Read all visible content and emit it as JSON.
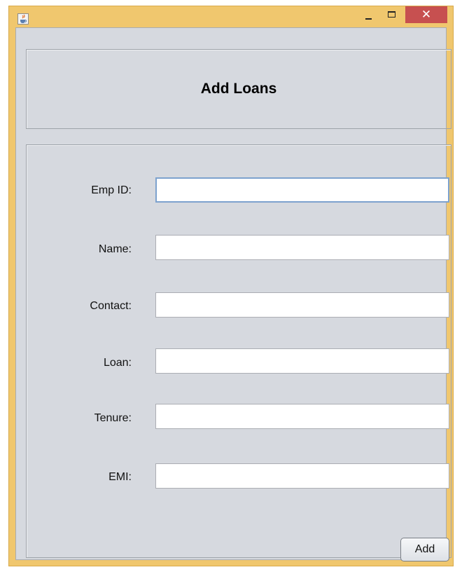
{
  "window": {
    "title": "",
    "controls": {
      "close_glyph": "✕"
    }
  },
  "header": {
    "title": "Add Loans"
  },
  "form": {
    "fields": [
      {
        "label": "Emp ID:",
        "value": "",
        "focused": true
      },
      {
        "label": "Name:",
        "value": "",
        "focused": false
      },
      {
        "label": "Contact:",
        "value": "",
        "focused": false
      },
      {
        "label": "Loan:",
        "value": "",
        "focused": false
      },
      {
        "label": "Tenure:",
        "value": "",
        "focused": false
      },
      {
        "label": "EMI:",
        "value": "",
        "focused": false
      }
    ],
    "add_label": "Add"
  },
  "colors": {
    "window_frame": "#f0c76e",
    "content_bg": "#d6d9df",
    "close_button": "#c75050",
    "focus_border": "#7da2ce"
  },
  "icons": {
    "app": "java-cup-icon",
    "minimize": "minimize-icon",
    "maximize": "maximize-icon",
    "close": "close-icon"
  }
}
